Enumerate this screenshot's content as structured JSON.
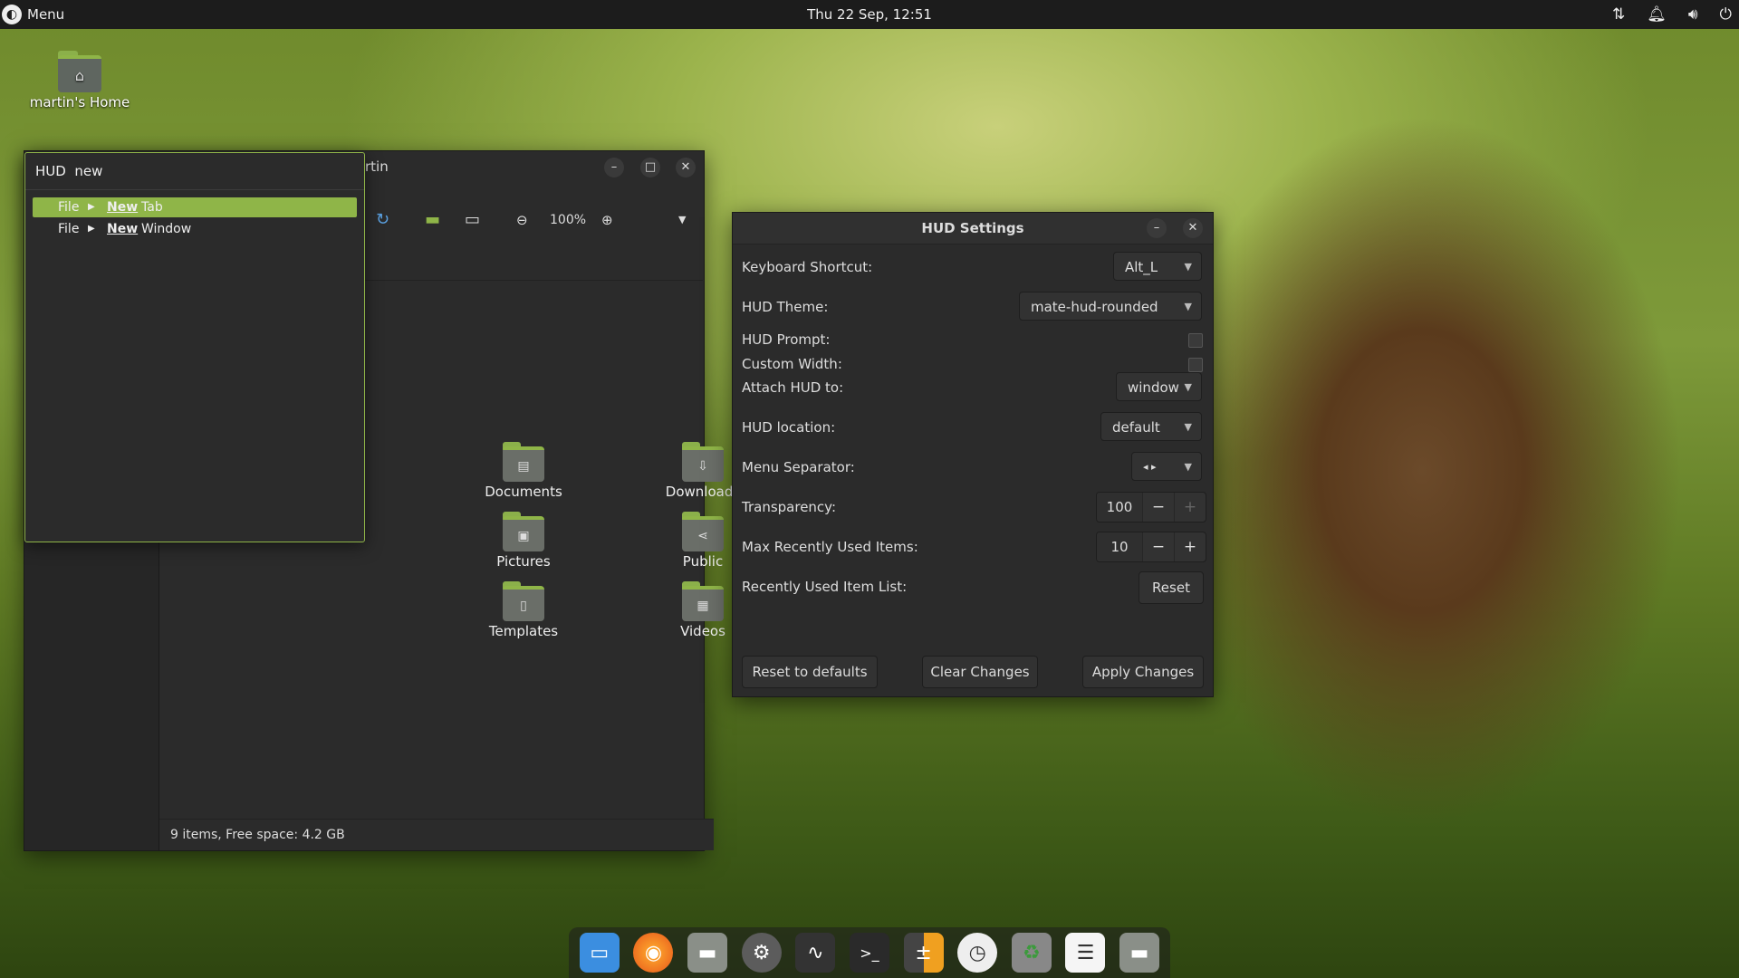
{
  "top_panel": {
    "menu_label": "Menu",
    "clock": "Thu 22 Sep, 12:51",
    "tray_icons": [
      "network-icon",
      "notification-bell-icon",
      "volume-icon",
      "power-icon"
    ]
  },
  "desktop": {
    "home_icon_label": "martin's Home"
  },
  "file_manager": {
    "title_fragment": "rtin",
    "zoom_level": "100%",
    "items": [
      {
        "name": "Documents",
        "icon": "document-glyph"
      },
      {
        "name": "Downloads",
        "icon": "download-glyph"
      },
      {
        "name": "Pictures",
        "icon": "picture-glyph"
      },
      {
        "name": "Public",
        "icon": "share-glyph"
      },
      {
        "name": "Templates",
        "icon": "template-glyph"
      },
      {
        "name": "Videos",
        "icon": "video-glyph"
      }
    ],
    "status": "9 items, Free space: 4.2 GB"
  },
  "hud": {
    "query": "HUD  new",
    "results": [
      {
        "menu": "File",
        "match": "New",
        "rest": "Tab",
        "selected": true
      },
      {
        "menu": "File",
        "match": "New",
        "rest": "Window",
        "selected": false
      }
    ]
  },
  "hud_settings": {
    "title": "HUD Settings",
    "keyboard_shortcut_label": "Keyboard Shortcut:",
    "keyboard_shortcut_value": "Alt_L",
    "theme_label": "HUD Theme:",
    "theme_value": "mate-hud-rounded",
    "prompt_label": "HUD Prompt:",
    "custom_width_label": "Custom Width:",
    "attach_label": "Attach HUD to:",
    "attach_value": "window",
    "location_label": "HUD location:",
    "location_value": "default",
    "separator_label": "Menu Separator:",
    "separator_value": "◂ ▸",
    "transparency_label": "Transparency:",
    "transparency_value": "100",
    "max_recent_label": "Max Recently Used Items:",
    "max_recent_value": "10",
    "recent_list_label": "Recently Used Item List:",
    "reset_label": "Reset",
    "reset_defaults_label": "Reset to defaults",
    "clear_changes_label": "Clear Changes",
    "apply_changes_label": "Apply Changes"
  },
  "dock": {
    "items": [
      "show-desktop-icon",
      "firefox-icon",
      "files-icon",
      "settings-icon",
      "system-monitor-icon",
      "terminal-icon",
      "calculator-icon",
      "clock-icon",
      "trash-icon",
      "text-editor-icon",
      "home-folder-icon"
    ]
  }
}
